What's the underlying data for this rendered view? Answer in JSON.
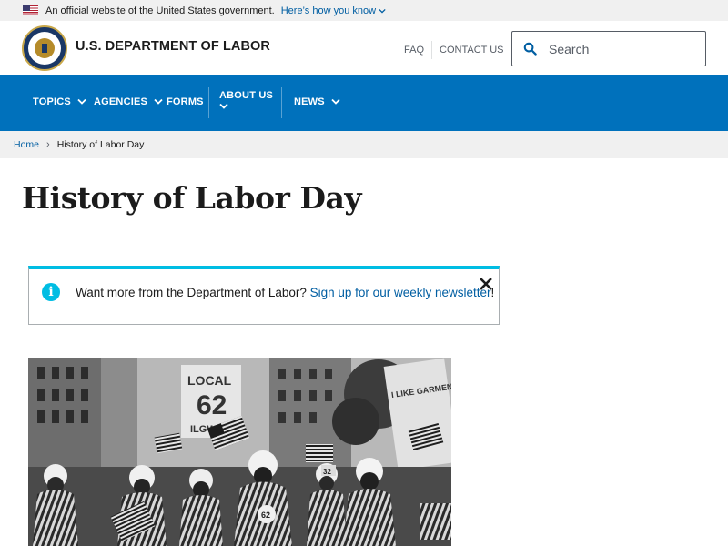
{
  "gov_banner": {
    "text": "An official website of the United States government.",
    "link": "Here’s how you know"
  },
  "header": {
    "dept_name": "U.S. DEPARTMENT OF LABOR",
    "faq": "FAQ",
    "contact": "CONTACT US",
    "search_placeholder": "Search"
  },
  "nav": {
    "items": [
      {
        "label": "TOPICS"
      },
      {
        "label": "AGENCIES"
      },
      {
        "label": "FORMS"
      },
      {
        "label": "ABOUT US"
      },
      {
        "label": "NEWS"
      }
    ]
  },
  "breadcrumb": {
    "home": "Home",
    "current": "History of Labor Day"
  },
  "page": {
    "title": "History of Labor Day"
  },
  "alert": {
    "text_before": "Want more from the Department of Labor?",
    "link": "Sign up for our weekly newsletter",
    "text_after": "!"
  },
  "photo": {
    "sign_local": "LOCAL",
    "sign_number": "62",
    "sign_union": "ILGWU",
    "sign_right": "I LIKE GARMENTS WITH THIS UNION",
    "badge_62": "62",
    "badge_32": "32"
  },
  "colors": {
    "nav_blue": "#0071bc",
    "link_blue": "#005ea2",
    "alert_cyan": "#00bde3"
  }
}
